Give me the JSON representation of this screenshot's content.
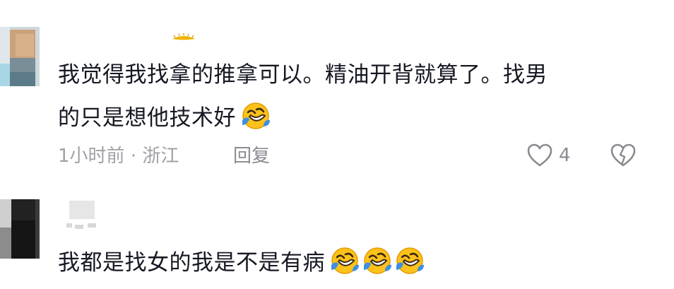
{
  "comments": [
    {
      "text_lines": [
        "我觉得我找拿的推拿可以。精油开背就算了。找男",
        "的只是想他技术好"
      ],
      "emoji_icons": [
        "rofl-emoji-icon"
      ],
      "time_location": "1小时前 · 浙江",
      "reply_label": "回复",
      "like_count": "4"
    },
    {
      "text": "我都是找女的我是不是有病",
      "emoji_icons": [
        "rofl-emoji-icon",
        "rofl-emoji-icon",
        "rofl-emoji-icon"
      ]
    }
  ]
}
